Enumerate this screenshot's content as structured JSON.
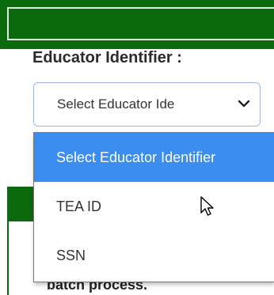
{
  "field": {
    "label": "Educator Identifier :",
    "selected_value": "Select Educator Ide",
    "chevron_icon": "chevron-down-icon"
  },
  "dropdown": {
    "options": [
      {
        "label": "Select Educator Identifier",
        "highlighted": true
      },
      {
        "label": "TEA ID",
        "highlighted": false
      },
      {
        "label": "SSN",
        "highlighted": false
      }
    ]
  },
  "background": {
    "partial_text": "batch process."
  },
  "colors": {
    "header_green": "#0b6a0b",
    "highlight_blue": "#3c8df0"
  },
  "cursor_icon": "mouse-pointer-icon"
}
